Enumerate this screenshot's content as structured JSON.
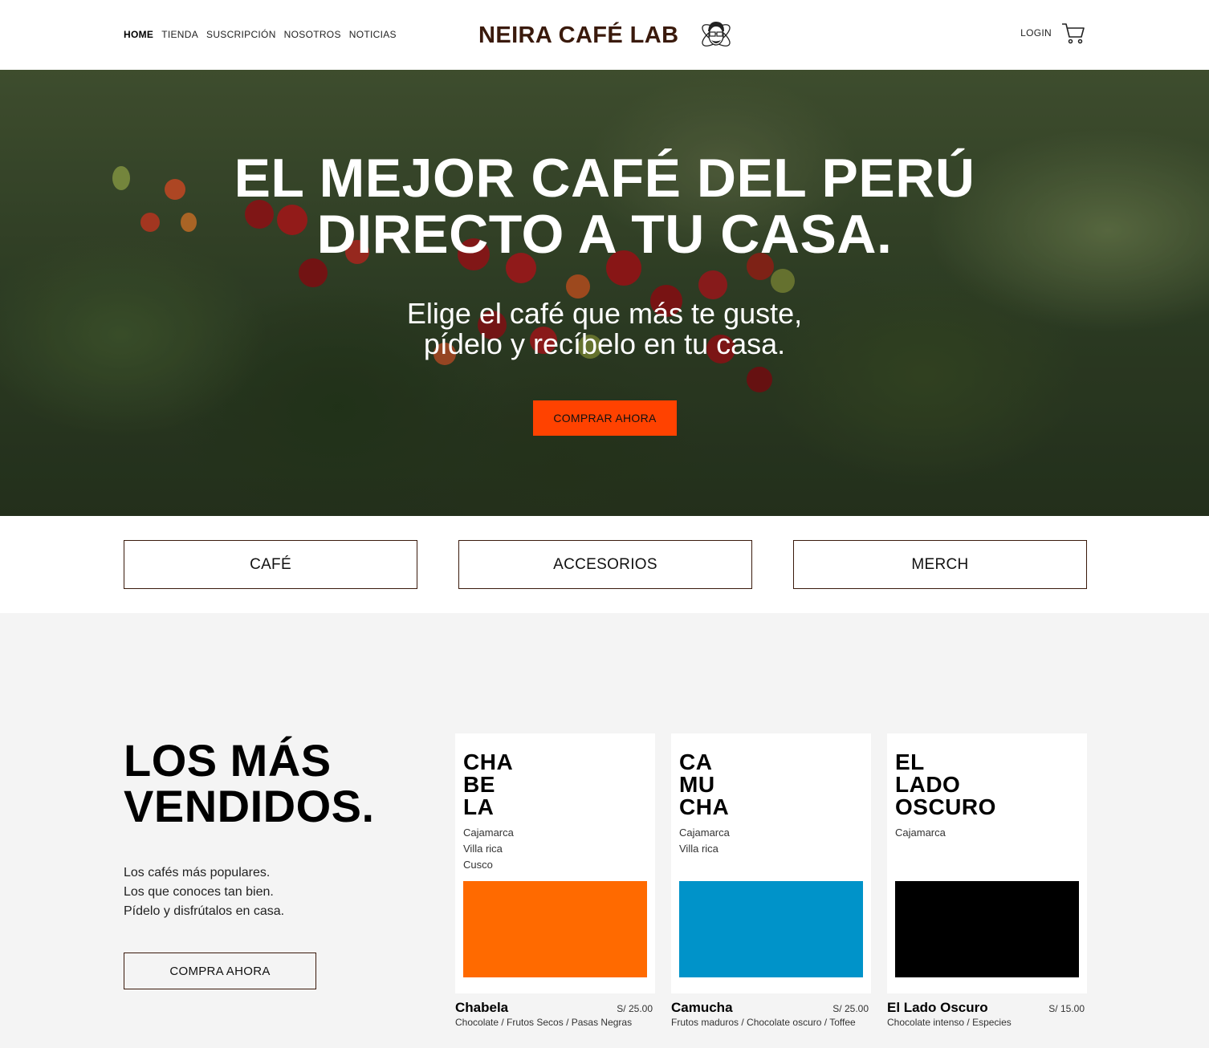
{
  "header": {
    "nav": [
      {
        "label": "HOME",
        "active": true
      },
      {
        "label": "TIENDA",
        "active": false
      },
      {
        "label": "SUSCRIPCIÓN",
        "active": false
      },
      {
        "label": "NOSOTROS",
        "active": false
      },
      {
        "label": "NOTICIAS",
        "active": false
      }
    ],
    "brand": "NEIRA CAFÉ LAB",
    "login": "LOGIN",
    "logo_icon": "coffee-face-logo-icon",
    "cart_icon": "shopping-cart-icon"
  },
  "hero": {
    "title": "EL MEJOR CAFÉ DEL  PERÚ\nDIRECTO A TU CASA.",
    "subtitle": "Elige el café que más te guste,\npídelo y recíbelo en tu casa.",
    "button": "COMPRAR AHORA",
    "button_color": "#ff4200"
  },
  "categories": [
    "CAFÉ",
    "ACCESORIOS",
    "MERCH"
  ],
  "best_sellers": {
    "title": "LOS MÁS\nVENDIDOS.",
    "description": "Los cafés más populares.\nLos que conoces tan bien.\nPídelo y disfrútalos en casa.",
    "button": "COMPRA AHORA",
    "products": [
      {
        "card_name": "CHA\nBE\nLA",
        "origins": [
          "Cajamarca",
          "Villa rica",
          "Cusco"
        ],
        "swatch": "#ff6a00",
        "title": "Chabela",
        "price": "S/ 25.00",
        "notes": "Chocolate / Frutos Secos / Pasas Negras"
      },
      {
        "card_name": "CA\nMU\nCHA",
        "origins": [
          "Cajamarca",
          "Villa rica"
        ],
        "swatch": "#0093c9",
        "title": "Camucha",
        "price": "S/ 25.00",
        "notes": "Frutos maduros / Chocolate oscuro / Toffee"
      },
      {
        "card_name": "EL\nLADO\nOSCURO",
        "origins": [
          "Cajamarca"
        ],
        "swatch": "#000000",
        "title": "El Lado Oscuro",
        "price": "S/ 15.00",
        "notes": "Chocolate intenso / Especies"
      }
    ]
  }
}
